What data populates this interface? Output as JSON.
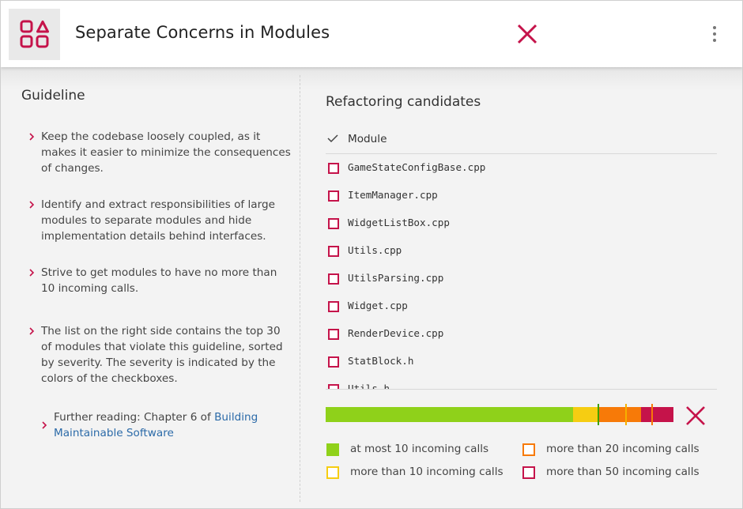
{
  "header": {
    "title": "Separate Concerns in Modules",
    "logo_icon": "modules-grid-icon",
    "close_icon": "close-icon",
    "menu_icon": "more-vertical-icon"
  },
  "colors": {
    "accent": "#c5134a",
    "green": "#8fd11a",
    "yellow": "#f6cd12",
    "orange": "#f77a08",
    "red": "#c5134a",
    "link": "#2b6aa8"
  },
  "guideline": {
    "title": "Guideline",
    "items": [
      "Keep the codebase loosely coupled, as it makes it easier to minimize the consequences of changes.",
      "Identify and extract responsibilities of large modules to separate modules and hide implementation details behind interfaces.",
      "Strive to get modules to have no more than 10 incoming calls.",
      "The list on the right side contains the top 30 of modules that violate this guideline, sorted by severity. The severity is indicated by the colors of the checkboxes."
    ],
    "further_reading_prefix": "Further reading: Chapter 6 of ",
    "further_reading_link": "Building Maintainable Software"
  },
  "candidates": {
    "title": "Refactoring candidates",
    "column_header": "Module",
    "modules": [
      "GameStateConfigBase.cpp",
      "ItemManager.cpp",
      "WidgetListBox.cpp",
      "Utils.cpp",
      "UtilsParsing.cpp",
      "Widget.cpp",
      "RenderDevice.cpp",
      "StatBlock.h",
      "Utils.h"
    ]
  },
  "severity_bar": {
    "segments": [
      {
        "name": "at most 10 incoming calls",
        "fraction": 0.711,
        "color": "#8fd11a"
      },
      {
        "name": "more than 10 incoming calls",
        "fraction": 0.075,
        "color": "#f6cd12"
      },
      {
        "name": "more than 20 incoming calls",
        "fraction": 0.12,
        "color": "#f77a08"
      },
      {
        "name": "more than 50 incoming calls",
        "fraction": 0.094,
        "color": "#c5134a"
      }
    ],
    "markers": [
      {
        "position": 0.785,
        "color": "#3fa000"
      },
      {
        "position": 0.864,
        "color": "#f6b000"
      },
      {
        "position": 0.939,
        "color": "#f77a08"
      }
    ]
  },
  "legend": [
    {
      "label": "at most 10 incoming calls",
      "color": "#8fd11a",
      "filled": true
    },
    {
      "label": "more than 20 incoming calls",
      "color": "#f77a08",
      "filled": false
    },
    {
      "label": "more than 10 incoming calls",
      "color": "#f6cd12",
      "filled": false
    },
    {
      "label": "more than 50 incoming calls",
      "color": "#c5134a",
      "filled": false
    }
  ]
}
